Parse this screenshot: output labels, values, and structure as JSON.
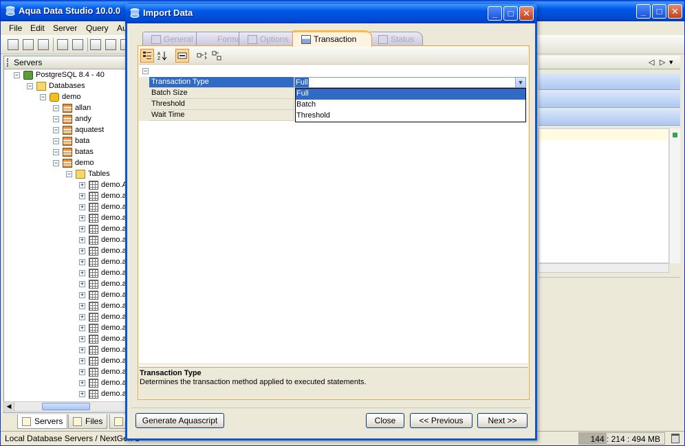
{
  "app": {
    "title": "Aqua Data Studio 10.0.0",
    "menu": [
      "File",
      "Edit",
      "Server",
      "Query",
      "Au"
    ],
    "servers_panel": {
      "title": "Servers",
      "tree": [
        {
          "label": "PostgreSQL 8.4 - 40",
          "icon": "server-icon",
          "depth": 0
        },
        {
          "label": "Databases",
          "icon": "folder-icon",
          "depth": 1
        },
        {
          "label": "demo",
          "icon": "database-icon",
          "depth": 2
        },
        {
          "label": "allan",
          "icon": "schema-icon",
          "depth": 3
        },
        {
          "label": "andy",
          "icon": "schema-icon",
          "depth": 3
        },
        {
          "label": "aquatest",
          "icon": "schema-icon",
          "depth": 3
        },
        {
          "label": "bata",
          "icon": "schema-icon",
          "depth": 3
        },
        {
          "label": "batas",
          "icon": "schema-icon",
          "depth": 3
        },
        {
          "label": "demo",
          "icon": "schema-icon",
          "depth": 3
        },
        {
          "label": "Tables",
          "icon": "folder-open-icon",
          "depth": 4
        },
        {
          "label": "demo.A",
          "icon": "table-icon",
          "depth": 5
        },
        {
          "label": "demo.a",
          "icon": "table-icon",
          "depth": 5
        },
        {
          "label": "demo.a",
          "icon": "table-icon",
          "depth": 5
        },
        {
          "label": "demo.a",
          "icon": "table-icon",
          "depth": 5
        },
        {
          "label": "demo.a",
          "icon": "table-icon",
          "depth": 5
        },
        {
          "label": "demo.a",
          "icon": "table-icon",
          "depth": 5
        },
        {
          "label": "demo.a",
          "icon": "table-icon",
          "depth": 5
        },
        {
          "label": "demo.a",
          "icon": "table-icon",
          "depth": 5
        },
        {
          "label": "demo.a",
          "icon": "table-icon",
          "depth": 5
        },
        {
          "label": "demo.a",
          "icon": "table-icon",
          "depth": 5
        },
        {
          "label": "demo.a",
          "icon": "table-icon",
          "depth": 5
        },
        {
          "label": "demo.a",
          "icon": "table-icon",
          "depth": 5
        },
        {
          "label": "demo.a",
          "icon": "table-icon",
          "depth": 5
        },
        {
          "label": "demo.a",
          "icon": "table-icon",
          "depth": 5
        },
        {
          "label": "demo.a",
          "icon": "table-icon",
          "depth": 5
        },
        {
          "label": "demo.a",
          "icon": "table-icon",
          "depth": 5
        },
        {
          "label": "demo.a",
          "icon": "table-icon",
          "depth": 5
        },
        {
          "label": "demo.a",
          "icon": "table-icon",
          "depth": 5
        },
        {
          "label": "demo.a",
          "icon": "table-icon",
          "depth": 5
        },
        {
          "label": "demo.a",
          "icon": "table-icon",
          "depth": 5
        }
      ]
    },
    "bottom_tabs": [
      "Servers",
      "Files"
    ],
    "status": {
      "left_text": "Local Database Servers / NextGen S",
      "memory": "144 : 214 : 494 MB"
    }
  },
  "dialog": {
    "title": "Import Data",
    "tabs": [
      {
        "label": "General",
        "active": false
      },
      {
        "label": "Format",
        "active": false
      },
      {
        "label": "Options",
        "active": false
      },
      {
        "label": "Transaction",
        "active": true
      },
      {
        "label": "Status",
        "active": false
      }
    ],
    "collapse_glyph": "−",
    "properties": [
      {
        "key": "Transaction Type",
        "selected": true
      },
      {
        "key": "Batch Size",
        "selected": false
      },
      {
        "key": "Threshold",
        "selected": false
      },
      {
        "key": "Wait Time",
        "selected": false
      }
    ],
    "combo": {
      "value": "Full",
      "options": [
        "Full",
        "Batch",
        "Threshold"
      ],
      "selected_index": 0
    },
    "description": {
      "title": "Transaction Type",
      "text": "Determines the transaction method applied to executed statements."
    },
    "buttons": {
      "generate": "Generate Aquascript",
      "close": "Close",
      "previous": "<< Previous",
      "next": "Next >>"
    }
  }
}
